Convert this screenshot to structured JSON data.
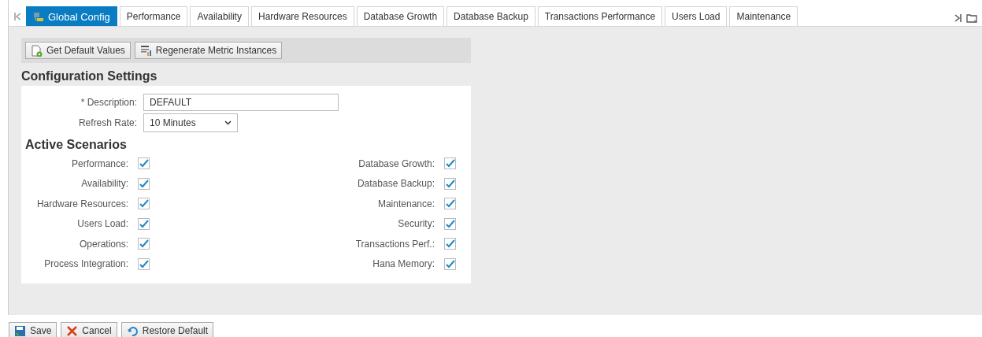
{
  "tabs": [
    {
      "label": "Global Config",
      "selected": true
    },
    {
      "label": "Performance",
      "selected": false
    },
    {
      "label": "Availability",
      "selected": false
    },
    {
      "label": "Hardware Resources",
      "selected": false
    },
    {
      "label": "Database Growth",
      "selected": false
    },
    {
      "label": "Database Backup",
      "selected": false
    },
    {
      "label": "Transactions Performance",
      "selected": false
    },
    {
      "label": "Users Load",
      "selected": false
    },
    {
      "label": "Maintenance",
      "selected": false
    }
  ],
  "toolbar": [
    "Get Default Values",
    "Regenerate Metric Instances"
  ],
  "section_title": "Configuration Settings",
  "description": {
    "label": "* Description:",
    "value": "DEFAULT"
  },
  "refresh_rate": {
    "label": "Refresh Rate:",
    "value": "10 Minutes"
  },
  "scenarios_title": "Active Scenarios",
  "scenarios_left": [
    {
      "label": "Performance:",
      "checked": true
    },
    {
      "label": "Availability:",
      "checked": true
    },
    {
      "label": "Hardware Resources:",
      "checked": true
    },
    {
      "label": "Users Load:",
      "checked": true
    },
    {
      "label": "Operations:",
      "checked": true
    },
    {
      "label": "Process Integration:",
      "checked": true
    }
  ],
  "scenarios_right": [
    {
      "label": "Database Growth:",
      "checked": true
    },
    {
      "label": "Database Backup:",
      "checked": true
    },
    {
      "label": "Maintenance:",
      "checked": true
    },
    {
      "label": "Security:",
      "checked": true
    },
    {
      "label": "Transactions Perf.:",
      "checked": true
    },
    {
      "label": "Hana Memory:",
      "checked": true
    }
  ],
  "footer_buttons": [
    "Save",
    "Cancel",
    "Restore Default"
  ]
}
